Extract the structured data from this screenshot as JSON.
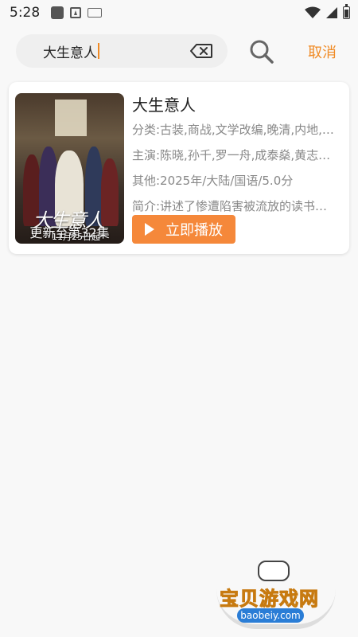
{
  "status_bar": {
    "time": "5:28"
  },
  "search": {
    "query": "大生意人",
    "cancel_label": "取消"
  },
  "result": {
    "title": "大生意人",
    "category": "分类:古装,商战,文学改编,晚清,内地,…",
    "cast": "主演:陈晓,孙千,罗一舟,成泰燊,黄志…",
    "other": "其他:2025年/大陆/国语/5.0分",
    "intro": "简介:讲述了惨遭陷害被流放的读书…",
    "poster_title": "大生意人",
    "poster_date": "11月25日起",
    "update_label": "更新至第32集",
    "play_label": "立即播放"
  },
  "watermark": {
    "name": "宝贝游戏网",
    "url": "baobeiy.com"
  },
  "colors": {
    "accent": "#f5883a",
    "cancel": "#f08a24"
  }
}
